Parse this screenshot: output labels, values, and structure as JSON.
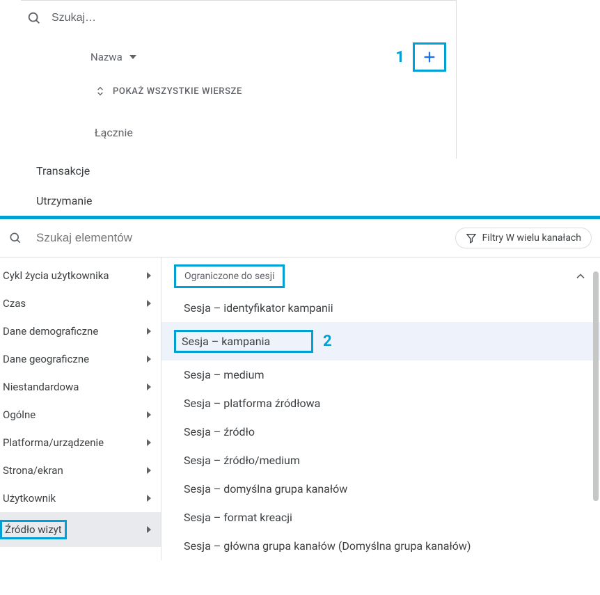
{
  "top": {
    "search_placeholder": "Szukaj…",
    "name_label": "Nazwa",
    "expand_label": "POKAŻ WSZYSTKIE WIERSZE",
    "total_label": "Łącznie",
    "tab_transactions": "Transakcje",
    "tab_retention": "Utrzymanie"
  },
  "callouts": {
    "one": "1",
    "two": "2"
  },
  "elements_search": {
    "placeholder": "Szukaj elementów",
    "filter_label": "Filtry W wielu kanałach"
  },
  "sidebar": {
    "items": [
      {
        "label": "Cykl życia użytkownika"
      },
      {
        "label": "Czas"
      },
      {
        "label": "Dane demograficzne"
      },
      {
        "label": "Dane geograficzne"
      },
      {
        "label": "Niestandardowa"
      },
      {
        "label": "Ogólne"
      },
      {
        "label": "Platforma/urządzenie"
      },
      {
        "label": "Strona/ekran"
      },
      {
        "label": "Użytkownik"
      },
      {
        "label": "Źródło wizyt"
      }
    ]
  },
  "detail": {
    "section_title": "Ograniczone do sesji",
    "options": [
      "Sesja – identyfikator kampanii",
      "Sesja – kampania",
      "Sesja – medium",
      "Sesja – platforma źródłowa",
      "Sesja – źródło",
      "Sesja – źródło/medium",
      "Sesja – domyślna grupa kanałów",
      "Sesja – format kreacji",
      "Sesja – główna grupa kanałów (Domyślna grupa kanałów)"
    ]
  }
}
